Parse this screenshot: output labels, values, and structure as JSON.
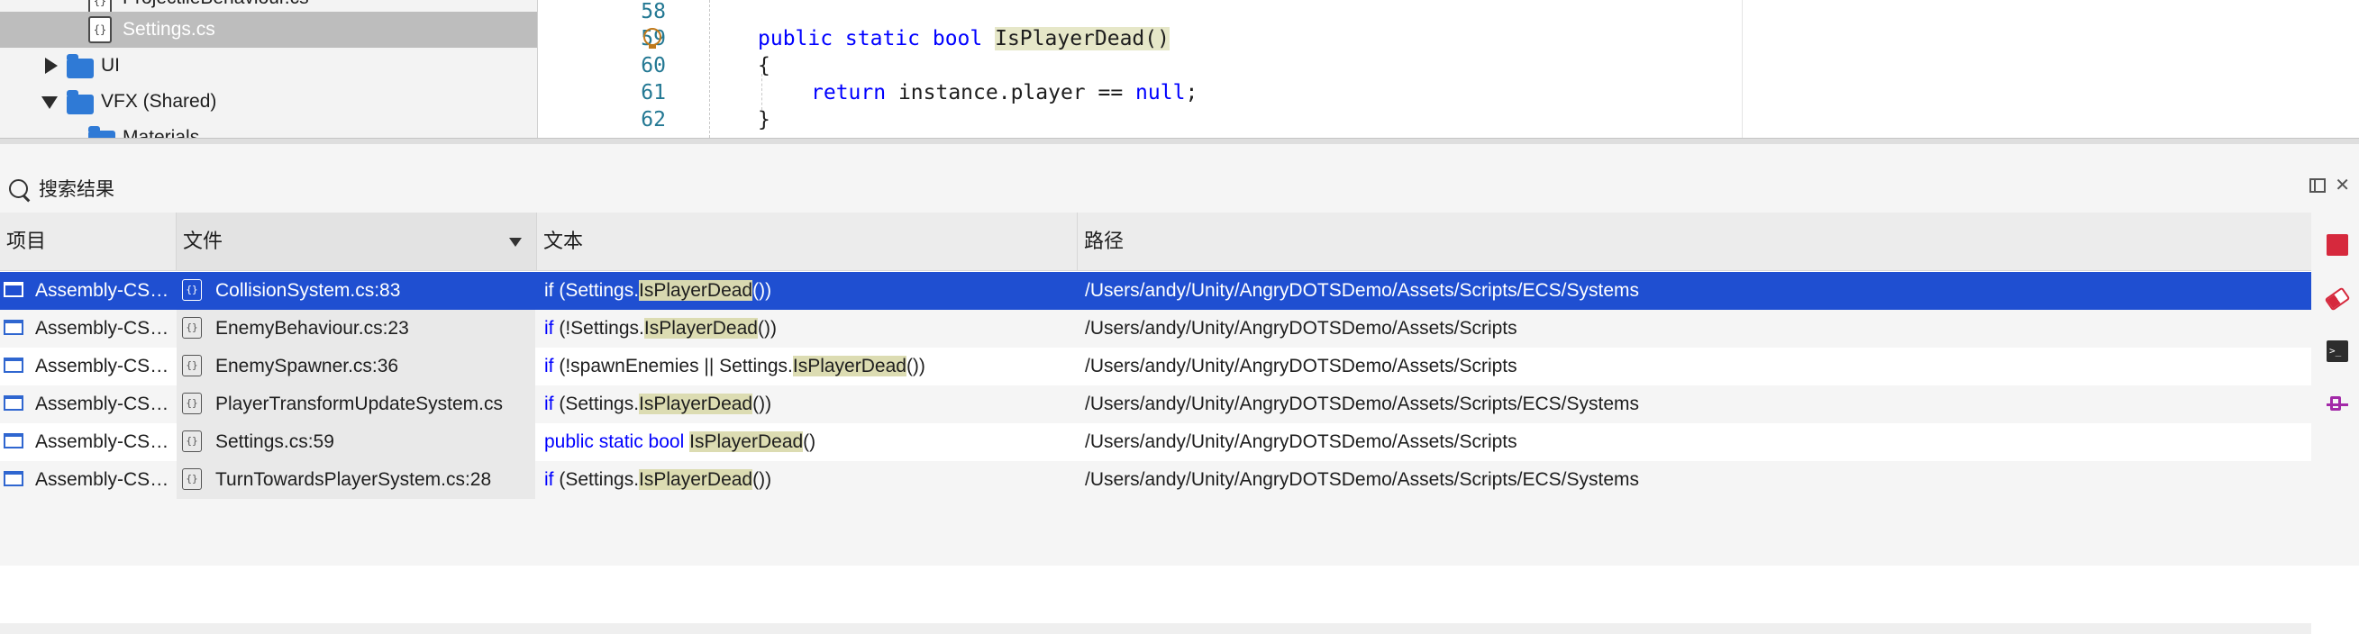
{
  "solution_tree": {
    "items": [
      {
        "label": "ProjectileBehaviour.cs",
        "kind": "file"
      },
      {
        "label": "Settings.cs",
        "kind": "file",
        "selected": true
      },
      {
        "label": "UI",
        "kind": "folder",
        "expanded": false
      },
      {
        "label": "VFX (Shared)",
        "kind": "folder",
        "expanded": true
      },
      {
        "label": "Materials",
        "kind": "folder"
      }
    ]
  },
  "editor": {
    "lines": [
      {
        "number": "58"
      },
      {
        "number": "59",
        "parts": {
          "kw": "public static bool ",
          "name": "IsPlayerDead",
          "tail": "()"
        }
      },
      {
        "number": "60",
        "text": "{"
      },
      {
        "number": "61",
        "parts": {
          "kw": "return",
          "mid": " instance.player == ",
          "kw2": "null",
          "tail": ";"
        }
      },
      {
        "number": "62",
        "text": "}"
      }
    ]
  },
  "results": {
    "title": "搜索结果",
    "columns": {
      "project": "项目",
      "file": "文件",
      "text": "文本",
      "path": "路径"
    },
    "rows": [
      {
        "project": "Assembly-CSharp",
        "file": "CollisionSystem.cs:83",
        "pre_kw": "",
        "pre": "if (Settings.",
        "match": "IsPlayerDead",
        "post": "())",
        "path": "/Users/andy/Unity/AngryDOTSDemo/Assets/Scripts/ECS/Systems"
      },
      {
        "project": "Assembly-CSharp",
        "file": "EnemyBehaviour.cs:23",
        "pre_kw": "if",
        "pre": " (!Settings.",
        "match": "IsPlayerDead",
        "post": "())",
        "path": "/Users/andy/Unity/AngryDOTSDemo/Assets/Scripts"
      },
      {
        "project": "Assembly-CSharp",
        "file": "EnemySpawner.cs:36",
        "pre_kw": "if",
        "pre": " (!spawnEnemies || Settings.",
        "match": "IsPlayerDead",
        "post": "())",
        "path": "/Users/andy/Unity/AngryDOTSDemo/Assets/Scripts"
      },
      {
        "project": "Assembly-CSharp",
        "file": "PlayerTransformUpdateSystem.cs",
        "pre_kw": "if",
        "pre": " (Settings.",
        "match": "IsPlayerDead",
        "post": "())",
        "path": "/Users/andy/Unity/AngryDOTSDemo/Assets/Scripts/ECS/Systems"
      },
      {
        "project": "Assembly-CSharp",
        "file": "Settings.cs:59",
        "pre_kw": "public static bool",
        "pre": " ",
        "match": "IsPlayerDead",
        "post": "()",
        "path": "/Users/andy/Unity/AngryDOTSDemo/Assets/Scripts"
      },
      {
        "project": "Assembly-CSharp",
        "file": "TurnTowardsPlayerSystem.cs:28",
        "pre_kw": "if",
        "pre": " (Settings.",
        "match": "IsPlayerDead",
        "post": "())",
        "path": "/Users/andy/Unity/AngryDOTSDemo/Assets/Scripts/ECS/Systems"
      }
    ],
    "selected_row": 0
  },
  "icons": {
    "search": "search-icon",
    "dock": "dock-icon",
    "close": "close-icon",
    "stop": "stop-icon",
    "clear": "eraser-icon",
    "terminal": "terminal-icon",
    "pin": "pin-icon"
  },
  "colors": {
    "selection": "#1f4fd1",
    "keyword": "#0000ff",
    "match_highlight": "#dcdcb2",
    "stop": "#d6293d"
  }
}
